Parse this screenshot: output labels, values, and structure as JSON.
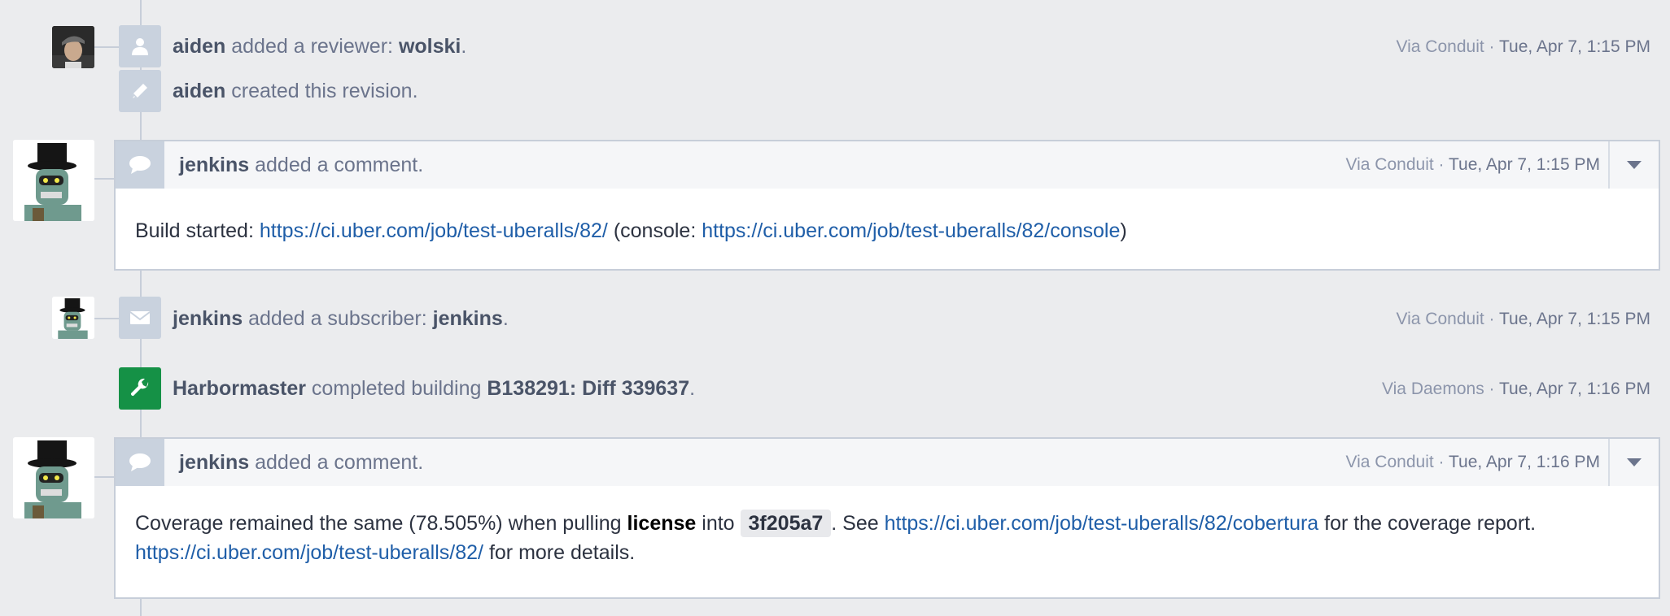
{
  "events": [
    {
      "actor": "aiden",
      "action": "added a reviewer:",
      "object": "wolski",
      "suffix": ".",
      "via": "Via Conduit",
      "sep": " · ",
      "date": "Tue, Apr 7, 1:15 PM",
      "icon": "user-icon"
    },
    {
      "actor": "aiden",
      "action": "created this revision.",
      "icon": "pencil-icon"
    },
    {
      "actor": "jenkins",
      "action": "added a subscriber:",
      "object": "jenkins",
      "suffix": ".",
      "via": "Via Conduit",
      "sep": " · ",
      "date": "Tue, Apr 7, 1:15 PM",
      "icon": "envelope-icon"
    },
    {
      "actor": "Harbormaster",
      "action": "completed building",
      "object": "B138291: Diff 339637",
      "suffix": ".",
      "via": "Via Daemons",
      "sep": " · ",
      "date": "Tue, Apr 7, 1:16 PM",
      "icon": "wrench-icon",
      "icon_color": "#159146"
    }
  ],
  "comments": [
    {
      "actor": "jenkins",
      "action": "added a comment.",
      "via": "Via Conduit",
      "sep": " · ",
      "date": "Tue, Apr 7, 1:15 PM",
      "body": {
        "prefix": "Build started:",
        "link1": "https://ci.uber.com/job/test-uberalls/82/",
        "middle": "(console:",
        "link2": "https://ci.uber.com/job/test-uberalls/82/console",
        "close": ")"
      }
    },
    {
      "actor": "jenkins",
      "action": "added a comment.",
      "via": "Via Conduit",
      "sep": " · ",
      "date": "Tue, Apr 7, 1:16 PM",
      "body": {
        "part1": "Coverage remained the same (78.505%) when pulling",
        "branch": "license",
        "into": "into",
        "commit": "3f205a7",
        "see": ". See",
        "link1": "https://ci.uber.com/job/test-uberalls/82/cobertura",
        "after": "for the coverage report.",
        "link2": "https://ci.uber.com/job/test-uberalls/82/",
        "details": "for more details."
      }
    }
  ],
  "colors": {
    "background": "#ebecee",
    "timeline": "#c7ced9",
    "icon_bg": "#c9d2de",
    "link": "#1f5ea8",
    "harbormaster": "#159146"
  }
}
